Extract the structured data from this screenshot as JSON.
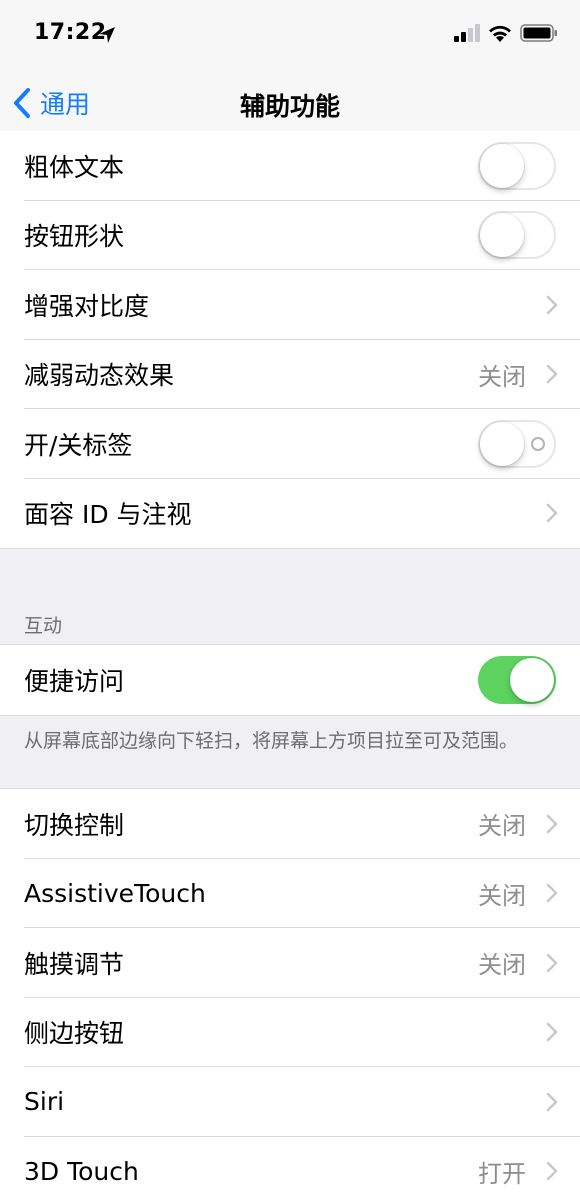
{
  "status_bar": {
    "time": "17:22",
    "icons": [
      "location-arrow-icon",
      "cellular-signal-icon",
      "wifi-icon",
      "battery-icon"
    ]
  },
  "nav": {
    "back_label": "通用",
    "title": "辅助功能"
  },
  "colors": {
    "accent": "#147efb",
    "toggle_on": "#5dd25f",
    "background": "#efeff4",
    "secondary_text": "#8e8e93"
  },
  "group1": [
    {
      "label": "粗体文本",
      "control": "toggle",
      "on": false
    },
    {
      "label": "按钮形状",
      "control": "toggle",
      "on": false
    },
    {
      "label": "增强对比度",
      "control": "disclosure"
    },
    {
      "label": "减弱动态效果",
      "control": "disclosure",
      "value": "关闭"
    },
    {
      "label": "开/关标签",
      "control": "toggle",
      "on": false
    },
    {
      "label": "面容 ID 与注视",
      "control": "disclosure"
    }
  ],
  "interaction": {
    "header": "互动",
    "row": {
      "label": "便捷访问",
      "control": "toggle",
      "on": true
    },
    "footer": "从屏幕底部边缘向下轻扫，将屏幕上方项目拉至可及范围。"
  },
  "group3": [
    {
      "label": "切换控制",
      "value": "关闭"
    },
    {
      "label": "AssistiveTouch",
      "value": "关闭"
    },
    {
      "label": "触摸调节",
      "value": "关闭"
    },
    {
      "label": "侧边按钮"
    },
    {
      "label": "Siri"
    },
    {
      "label": "3D Touch",
      "value": "打开"
    }
  ]
}
